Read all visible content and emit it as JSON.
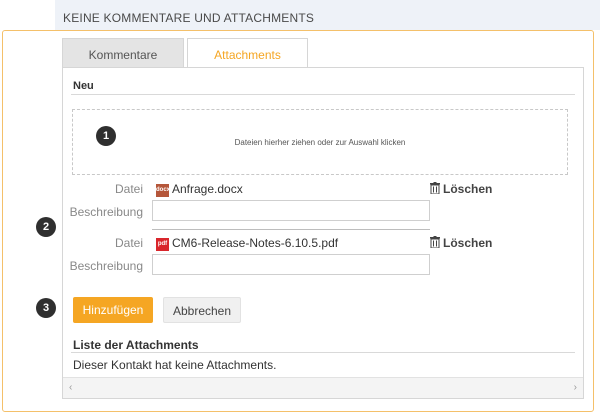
{
  "header": {
    "title": "KEINE KOMMENTARE UND ATTACHMENTS"
  },
  "tabs": [
    {
      "label": "Kommentare",
      "active": false
    },
    {
      "label": "Attachments",
      "active": true
    }
  ],
  "new_section": {
    "title": "Neu",
    "dropzone_text": "Dateien hierher ziehen oder zur Auswahl klicken"
  },
  "badges": [
    "1",
    "2",
    "3"
  ],
  "files": [
    {
      "file_label": "Datei",
      "desc_label": "Beschreibung",
      "icon_text": "docx",
      "icon": "docx-file-icon",
      "name": "Anfrage.docx",
      "delete_label": "Löschen",
      "description": ""
    },
    {
      "file_label": "Datei",
      "desc_label": "Beschreibung",
      "icon_text": "pdf",
      "icon": "pdf-file-icon",
      "name": "CM6-Release-Notes-6.10.5.pdf",
      "delete_label": "Löschen",
      "description": ""
    }
  ],
  "buttons": {
    "add": "Hinzufügen",
    "cancel": "Abbrechen"
  },
  "list": {
    "title": "Liste der Attachments",
    "empty": "Dieser Kontakt hat keine Attachments."
  },
  "scroll": {
    "left": "‹",
    "right": "›"
  },
  "colors": {
    "accent": "#f5a623",
    "frame": "#f4c06a",
    "badge": "#2f2f2f",
    "docx": "#b5563a",
    "pdf": "#d9262c"
  }
}
